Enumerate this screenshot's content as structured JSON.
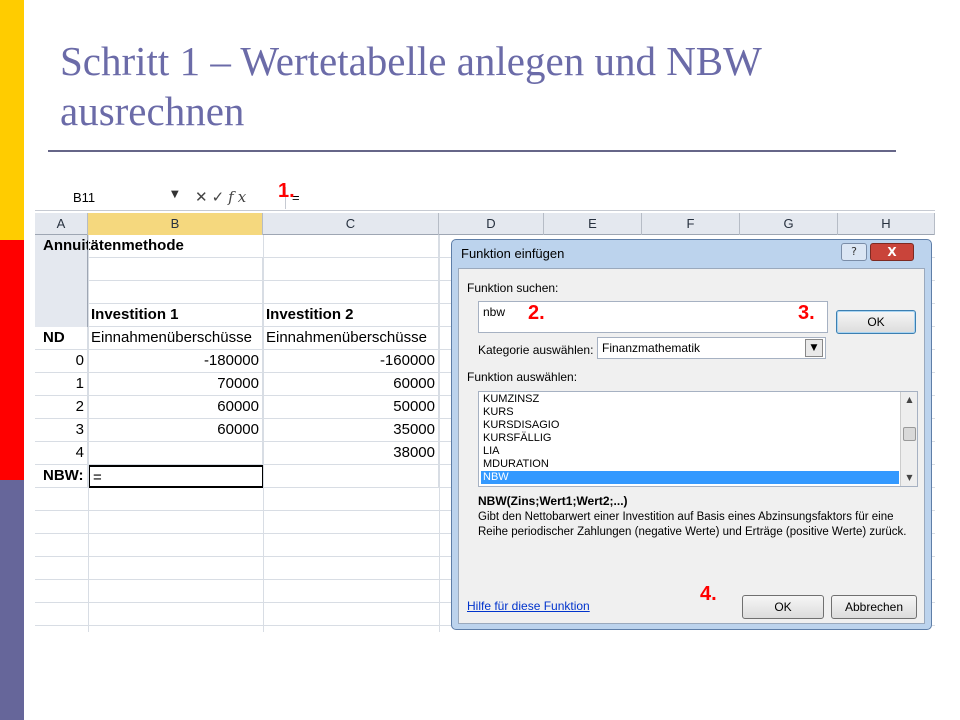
{
  "slide": {
    "title": "Schritt 1 – Wertetabelle anlegen und NBW ausrechnen"
  },
  "colors": {
    "accent_yellow": "#ffcc00",
    "accent_red": "#ff0000",
    "accent_purple": "#66669a",
    "title_color": "#6b6ba8",
    "step_marker": "#ff0000",
    "selected_item": "#3399ff"
  },
  "excel": {
    "namebox": "B11",
    "formula_icons": [
      "cancel-x-icon",
      "confirm-check-icon",
      "fx-icon"
    ],
    "formula_value": "=",
    "columns": [
      "A",
      "B",
      "C",
      "D",
      "E",
      "F",
      "G",
      "H"
    ],
    "active_column": "B",
    "rows": [
      {
        "a": "Annuitätenmethode",
        "b": "",
        "c": ""
      },
      {
        "a": "",
        "b": "",
        "c": ""
      },
      {
        "a": "",
        "b": "",
        "c": ""
      },
      {
        "a": "",
        "b": "Investition 1",
        "c": "Investition 2"
      },
      {
        "a": "ND",
        "b": "Einnahmenüberschüsse",
        "c": "Einnahmenüberschüsse"
      },
      {
        "a": "0",
        "b": "-180000",
        "c": "-160000"
      },
      {
        "a": "1",
        "b": "70000",
        "c": "60000"
      },
      {
        "a": "2",
        "b": "60000",
        "c": "50000"
      },
      {
        "a": "3",
        "b": "60000",
        "c": "35000"
      },
      {
        "a": "4",
        "b": "",
        "c": "38000"
      },
      {
        "a": "NBW:",
        "b": "=",
        "c": ""
      }
    ]
  },
  "dialog": {
    "title": "Funktion einfügen",
    "help_glyph": "?",
    "close_glyph": "X",
    "search_label": "Funktion suchen:",
    "search_value": "nbw",
    "go_button": "OK",
    "category_label": "Kategorie auswählen:",
    "category_value": "Finanzmathematik",
    "select_label": "Funktion auswählen:",
    "functions": [
      "KUMZINSZ",
      "KURS",
      "KURSDISAGIO",
      "KURSFÄLLIG",
      "LIA",
      "MDURATION",
      "NBW"
    ],
    "selected_function": "NBW",
    "signature": "NBW(Zins;Wert1;Wert2;...)",
    "description": "Gibt den Nettobarwert einer Investition auf Basis eines Abzinsungsfaktors für eine Reihe periodischer Zahlungen (negative Werte) und Erträge (positive Werte) zurück.",
    "help_link": "Hilfe für diese Funktion",
    "ok_button": "OK",
    "cancel_button": "Abbrechen"
  },
  "steps": [
    "1.",
    "2.",
    "3.",
    "4."
  ]
}
